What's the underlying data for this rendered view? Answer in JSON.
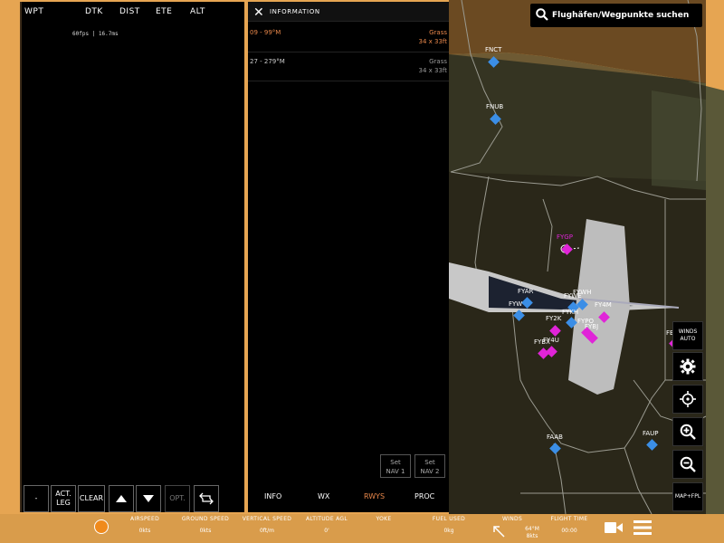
{
  "fpl": {
    "headers": {
      "wpt": "WPT",
      "dtk": "DTK",
      "dist": "DIST",
      "ete": "ETE",
      "alt": "ALT"
    },
    "fps": "60fps | 16.7ms",
    "buttons": {
      "minus": "-",
      "act_leg_1": "ACT.",
      "act_leg_2": "LEG",
      "clear": "CLEAR",
      "opt": "OPT."
    }
  },
  "info": {
    "title": "INFORMATION",
    "runways": [
      {
        "name": "09 - 99°M",
        "surface": "Grass",
        "dims": "34 x 33ft"
      },
      {
        "name": "27 - 279°M",
        "surface": "Grass",
        "dims": "34 x 33ft"
      }
    ],
    "set_nav1": [
      "Set",
      "NAV 1"
    ],
    "set_nav2": [
      "Set",
      "NAV 2"
    ],
    "tabs": [
      "INFO",
      "WX",
      "RWYS",
      "PROC"
    ],
    "active_tab": "RWYS"
  },
  "search": {
    "placeholder": "Flughäfen/Wegpunkte suchen"
  },
  "controls": {
    "winds": [
      "WINDS",
      "AUTO"
    ],
    "map_fpl": "MAP+FPL",
    "icons": [
      "gear-icon",
      "crosshair-icon",
      "zoom-in-icon",
      "zoom-out-icon"
    ]
  },
  "waypoints": [
    {
      "id": "FNCT",
      "color": "blue"
    },
    {
      "id": "FNUB",
      "color": "blue"
    },
    {
      "id": "FYGP",
      "color": "magenta"
    },
    {
      "id": "FYAR",
      "color": "blue"
    },
    {
      "id": "FYW",
      "color": "blue"
    },
    {
      "id": "FYWE",
      "color": "blue"
    },
    {
      "id": "FYWH",
      "color": "blue"
    },
    {
      "id": "FYKH",
      "color": "blue"
    },
    {
      "id": "FY4M",
      "color": "magenta"
    },
    {
      "id": "FY2K",
      "color": "magenta"
    },
    {
      "id": "FYPO",
      "color": "magenta"
    },
    {
      "id": "FYBJ",
      "color": "magenta"
    },
    {
      "id": "FY4U",
      "color": "magenta"
    },
    {
      "id": "FYBX",
      "color": "magenta"
    },
    {
      "id": "FBW",
      "color": "magenta"
    },
    {
      "id": "FAAB",
      "color": "blue"
    },
    {
      "id": "FAUP",
      "color": "blue"
    }
  ],
  "bottom": {
    "airspeed": {
      "label": "AIRSPEED",
      "value": "0kts"
    },
    "ground_speed": {
      "label": "GROUND SPEED",
      "value": "0kts"
    },
    "vertical_speed": {
      "label": "VERTICAL SPEED",
      "value": "0ft/m"
    },
    "altitude_agl": {
      "label": "ALTITUDE AGL",
      "value": "0'"
    },
    "yoke": {
      "label": "YOKE",
      "value": ""
    },
    "fuel_used": {
      "label": "FUEL USED",
      "value": "0kg"
    },
    "winds": {
      "label": "WINDS",
      "value_1": "64°M",
      "value_2": "8kts"
    },
    "flight_time": {
      "label": "FLIGHT TIME",
      "value": "00:00"
    }
  },
  "colors": {
    "accent": "#e8874a",
    "blue_wp": "#3b8ee6",
    "mag_wp": "#e024d8",
    "bg": "#e6a552"
  }
}
